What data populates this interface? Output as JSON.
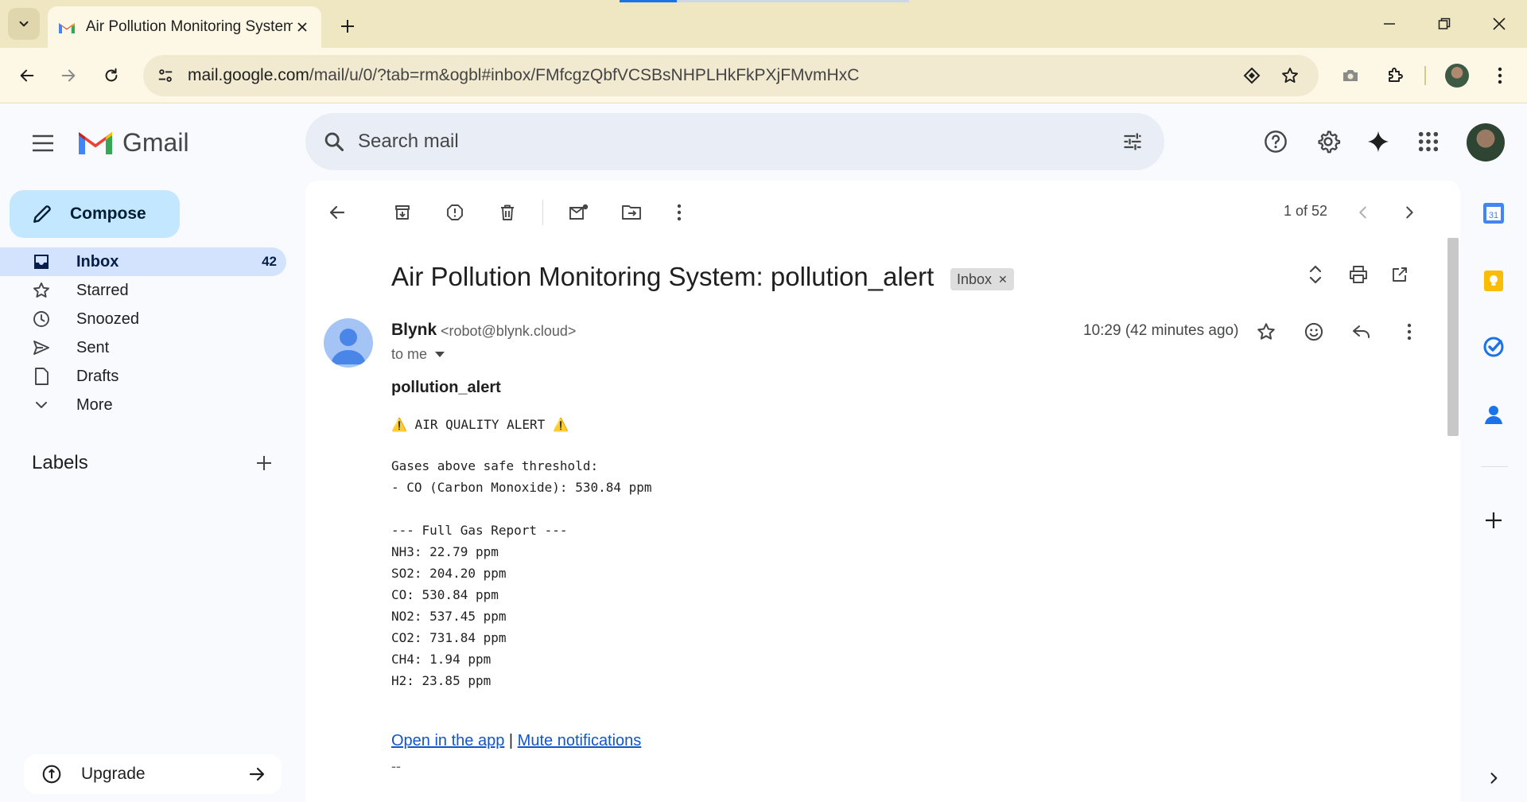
{
  "browser": {
    "tab_title": "Air Pollution Monitoring System",
    "url_host": "mail.google.com",
    "url_path": "/mail/u/0/?tab=rm&ogbl#inbox/FMfcgzQbfVCSBsNHPLHkFkPXjFMvmHxC"
  },
  "gmail": {
    "logo_text": "Gmail",
    "search_placeholder": "Search mail"
  },
  "sidebar": {
    "compose_label": "Compose",
    "items": [
      {
        "label": "Inbox",
        "count": "42"
      },
      {
        "label": "Starred"
      },
      {
        "label": "Snoozed"
      },
      {
        "label": "Sent"
      },
      {
        "label": "Drafts"
      },
      {
        "label": "More"
      }
    ],
    "labels_title": "Labels",
    "upgrade_label": "Upgrade"
  },
  "message": {
    "pager": "1 of 52",
    "subject": "Air Pollution Monitoring System: pollution_alert",
    "label_chip": "Inbox",
    "sender_name": "Blynk",
    "sender_email": "<robot@blynk.cloud>",
    "to": "to me",
    "timestamp": "10:29 (42 minutes ago)",
    "title": "pollution_alert",
    "alert_line": "⚠️ AIR QUALITY ALERT ⚠️",
    "threshold_heading": "Gases above safe threshold:",
    "threshold_item": "- CO (Carbon Monoxide): 530.84 ppm",
    "report_heading": "--- Full Gas Report ---",
    "report": [
      "NH3: 22.79 ppm",
      "SO2: 204.20 ppm",
      "CO: 530.84 ppm",
      "NO2: 537.45 ppm",
      "CO2: 731.84 ppm",
      "CH4: 1.94 ppm",
      "H2: 23.85 ppm"
    ],
    "link_open": "Open in the app",
    "link_separator": "|",
    "link_mute": "Mute notifications",
    "signature": "--"
  },
  "colors": {
    "tabstrip": "#efe6c2",
    "compose": "#c2e7ff",
    "inbox_active": "#d3e3fd",
    "link": "#1155cc",
    "page_bg": "#f8fafd"
  }
}
